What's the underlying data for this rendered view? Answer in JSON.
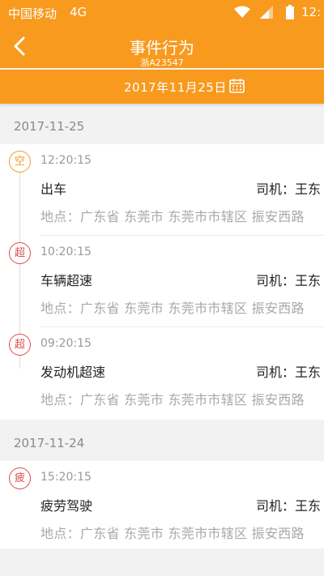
{
  "status_bar": {
    "carrier": "中国移动",
    "network": "4G",
    "time": "12:"
  },
  "header": {
    "title": "事件行为",
    "plate": "浙A23547",
    "back_icon": "back-arrow-icon"
  },
  "date_bar": {
    "date": "2017年11月25日",
    "calendar_icon": "calendar-icon"
  },
  "groups": [
    {
      "date": "2017-11-25",
      "events": [
        {
          "badge": "空",
          "badge_color": "#f29b1d",
          "time": "12:20:15",
          "event": "出车",
          "driver": "司机：王东",
          "location": "地点：广东省  东莞市  东莞市市辖区  振安西路"
        },
        {
          "badge": "超",
          "badge_color": "#e04a4a",
          "time": "10:20:15",
          "event": "车辆超速",
          "driver": "司机：王东",
          "location": "地点：广东省  东莞市  东莞市市辖区  振安西路"
        },
        {
          "badge": "超",
          "badge_color": "#e04a4a",
          "time": "09:20:15",
          "event": "发动机超速",
          "driver": "司机：王东",
          "location": "地点：广东省  东莞市  东莞市市辖区  振安西路"
        }
      ]
    },
    {
      "date": "2017-11-24",
      "events": [
        {
          "badge": "疲",
          "badge_color": "#e04a4a",
          "time": "15:20:15",
          "event": "疲劳驾驶",
          "driver": "司机：王东",
          "location": "地点：广东省  东莞市  东莞市市辖区  振安西路"
        }
      ]
    }
  ]
}
